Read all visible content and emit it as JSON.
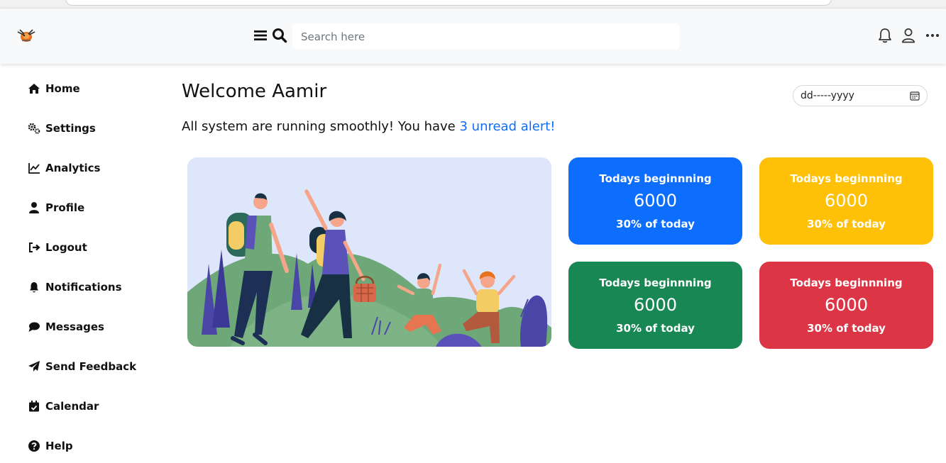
{
  "header": {
    "search_placeholder": "Search here"
  },
  "sidebar": {
    "items": [
      {
        "label": "Home",
        "icon": "home-icon"
      },
      {
        "label": "Settings",
        "icon": "cogs-icon"
      },
      {
        "label": "Analytics",
        "icon": "chart-line-icon"
      },
      {
        "label": "Profile",
        "icon": "user-icon"
      },
      {
        "label": "Logout",
        "icon": "sign-out-icon"
      },
      {
        "label": "Notifications",
        "icon": "bell-icon"
      },
      {
        "label": "Messages",
        "icon": "comment-icon"
      },
      {
        "label": "Send Feedback",
        "icon": "paper-plane-icon"
      },
      {
        "label": "Calendar",
        "icon": "calendar-check-icon"
      },
      {
        "label": "Help",
        "icon": "question-circle-icon"
      }
    ]
  },
  "main": {
    "welcome": "Welcome Aamir",
    "status_text": "All system are running smoothly! You have ",
    "alert_link": "3 unread alert!",
    "date_placeholder": "dd-----yyyy"
  },
  "cards": [
    {
      "title": "Todays beginnning",
      "value": "6000",
      "sub": "30% of today",
      "color": "#0d6efd"
    },
    {
      "title": "Todays beginnning",
      "value": "6000",
      "sub": "30% of today",
      "color": "#ffc107"
    },
    {
      "title": "Todays beginnning",
      "value": "6000",
      "sub": "30% of today",
      "color": "#198754"
    },
    {
      "title": "Todays beginnning",
      "value": "6000",
      "sub": "30% of today",
      "color": "#dc3545"
    }
  ],
  "colors": {
    "primary": "#0d6efd",
    "warning": "#ffc107",
    "success": "#198754",
    "danger": "#dc3545",
    "navbar_bg": "#f8f9fa",
    "hero_bg": "#dde6fb"
  }
}
